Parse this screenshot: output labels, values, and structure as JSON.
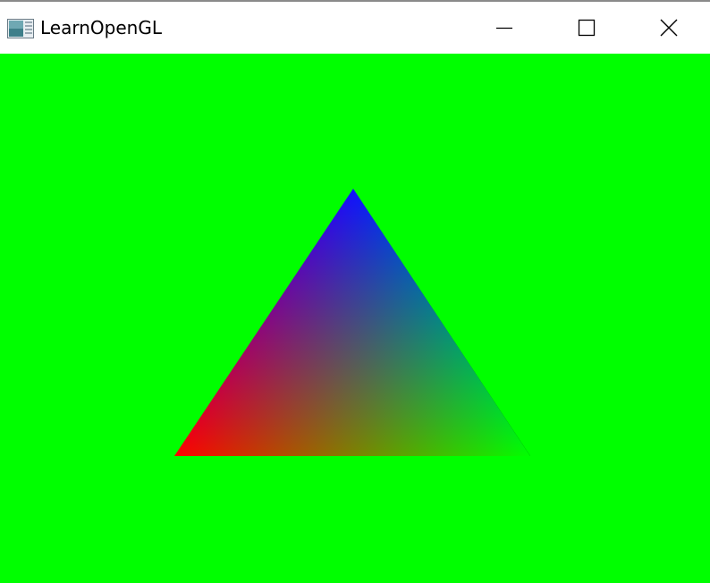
{
  "window": {
    "title": "LearnOpenGL",
    "icon": "window-app-icon",
    "controls": [
      {
        "name": "minimize",
        "icon": "minimize-icon"
      },
      {
        "name": "maximize",
        "icon": "maximize-icon"
      },
      {
        "name": "close",
        "icon": "close-icon"
      }
    ]
  },
  "scene": {
    "clear_color": "#00ff00",
    "triangle": {
      "vertex_colors": {
        "bottom_left": "#ff0000",
        "bottom_right": "#00ff00",
        "top": "#0000ff"
      }
    }
  }
}
